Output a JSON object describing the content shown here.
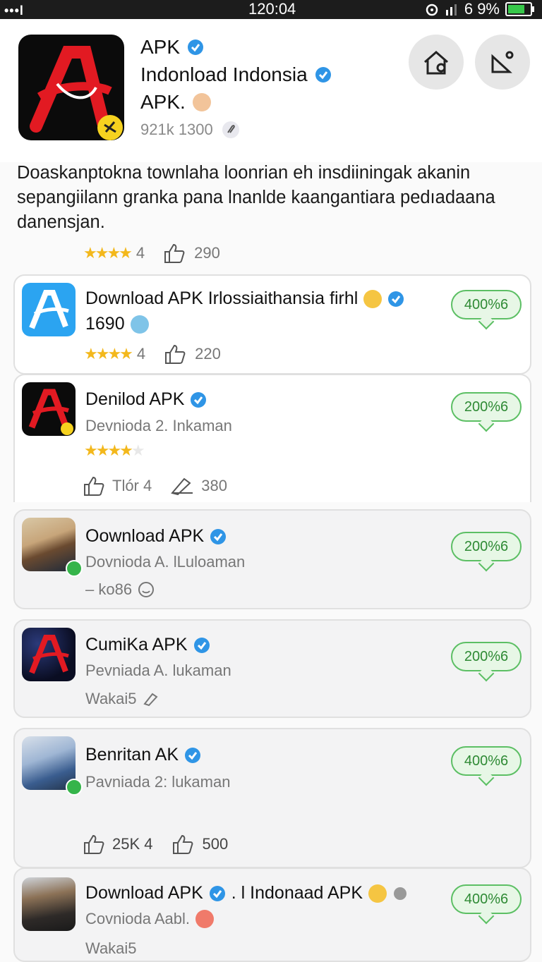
{
  "status": {
    "signal": "•••l",
    "time": "120:04",
    "battery_text": "6 9%",
    "battery_level": 0.9
  },
  "header": {
    "line1": "APK",
    "line2": "Indonload Indonsia",
    "line3": "APK.",
    "meta": "921k 1300",
    "buttons": [
      {
        "icon": "home-icon"
      },
      {
        "icon": "edit-icon"
      }
    ]
  },
  "description": "Doaskanptokna townlaha loonrian eh insdiiningak akanin sepangiilann granka pana lnanlde kaangantiara pedıadaana danensjan.",
  "summary_stats": {
    "rating": "4",
    "likes": "290"
  },
  "apps": [
    {
      "title": "Download APK Irlossiaithansia firhl",
      "sub": "1690",
      "rating": "4",
      "stars": 4,
      "likes": "220",
      "badge": "400%6"
    },
    {
      "title": "Denilod APK",
      "sub": "Devnioda 2. Inkaman",
      "stars": 4,
      "likes_label": "Tlór 4",
      "downloads": "380",
      "badge": "200%6"
    },
    {
      "title": "Oownload APK",
      "sub": "Dovnioda A. lLuloaman",
      "extra": "– ko86",
      "badge": "200%6"
    },
    {
      "title": "CumiKa APK",
      "sub": "Pevniada A. lukaman",
      "extra": "Wakai5",
      "badge": "200%6"
    },
    {
      "title": "Benritan AK",
      "sub": "Pavniada 2: lukaman",
      "likes_a": "25K 4",
      "likes_b": "500",
      "badge": "400%6"
    },
    {
      "title": "Download APK",
      "title2": ". l Indonaad APK",
      "sub": "Covnioda Aabl.",
      "extra": "Wakai5",
      "badge": "400%6"
    }
  ]
}
